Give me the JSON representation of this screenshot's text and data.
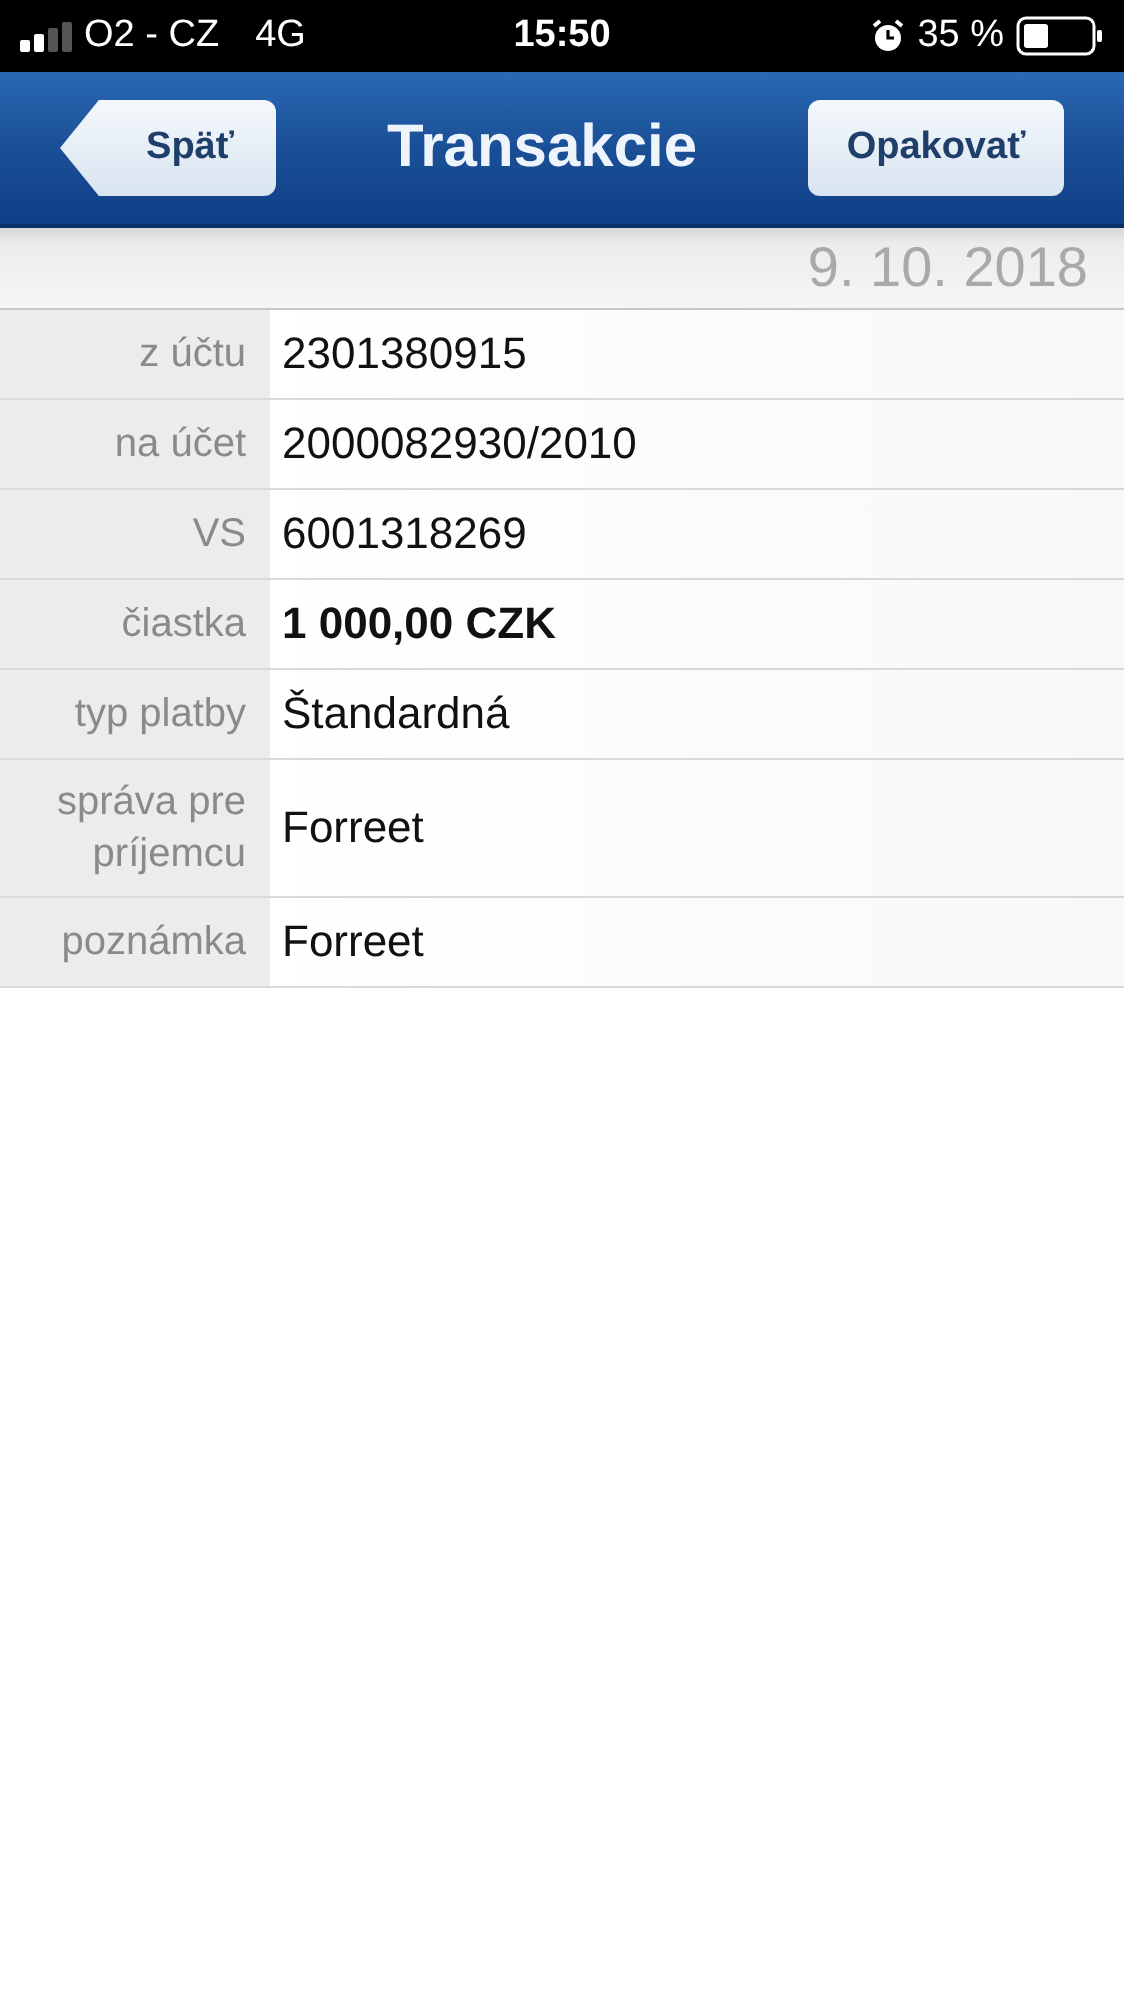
{
  "status_bar": {
    "carrier": "O2 - CZ",
    "network": "4G",
    "time": "15:50",
    "battery": "35 %"
  },
  "nav_bar": {
    "back_button": "Späť",
    "title": "Transakcie",
    "action_button": "Opakovať"
  },
  "date": "9. 10. 2018",
  "rows": [
    {
      "label": "z účtu",
      "value": "2301380915",
      "bold": false
    },
    {
      "label": "na účet",
      "value": "2000082930/2010",
      "bold": false
    },
    {
      "label": "VS",
      "value": "6001318269",
      "bold": false
    },
    {
      "label": "čiastka",
      "value": "1 000,00 CZK",
      "bold": true
    },
    {
      "label": "typ platby",
      "value": "Štandardná",
      "bold": false
    },
    {
      "label": "správa pre príjemcu",
      "value": "Forreet",
      "bold": false
    },
    {
      "label": "poznámka",
      "value": "Forreet",
      "bold": false
    }
  ]
}
